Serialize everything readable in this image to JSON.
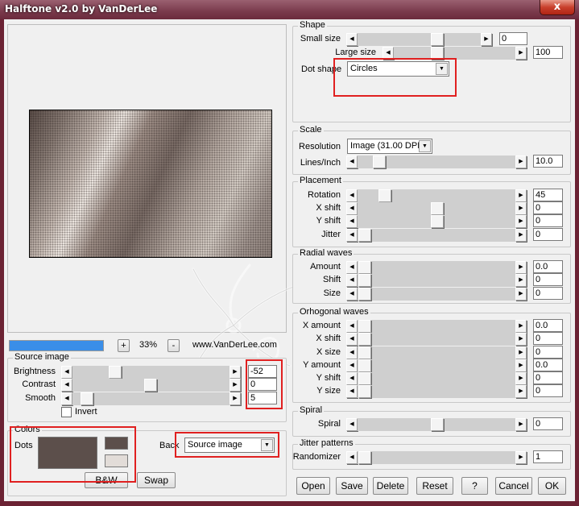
{
  "window": {
    "title": "Halftone v2.0 by VanDerLee",
    "close_glyph": "x"
  },
  "preview": {
    "zoom_minus": "+",
    "zoom_value": "33%",
    "zoom_plus": "-",
    "website": "www.VanDerLee.com"
  },
  "source_image": {
    "legend": "Source image",
    "brightness_label": "Brightness",
    "brightness_value": "-52",
    "contrast_label": "Contrast",
    "contrast_value": "0",
    "smooth_label": "Smooth",
    "smooth_value": "5",
    "invert_label": "Invert"
  },
  "colors": {
    "legend": "Colors",
    "dots_label": "Dots",
    "dots_color": "#5c4f4b",
    "fg_color": "#5c4f4b",
    "bg_color": "#e2dcd8",
    "bw_label": "B&W",
    "swap_label": "Swap",
    "back_label": "Back",
    "back_value": "Source image"
  },
  "shape": {
    "legend": "Shape",
    "small_size_label": "Small size",
    "small_size_value": "0",
    "large_size_label": "Large size",
    "large_size_value": "100",
    "dot_shape_label": "Dot shape",
    "dot_shape_value": "Circles"
  },
  "scale": {
    "legend": "Scale",
    "resolution_label": "Resolution",
    "resolution_value": "Image (31.00 DPI",
    "lines_label": "Lines/Inch",
    "lines_value": "10.0"
  },
  "placement": {
    "legend": "Placement",
    "rotation_label": "Rotation",
    "rotation_value": "45",
    "xshift_label": "X shift",
    "xshift_value": "0",
    "yshift_label": "Y shift",
    "yshift_value": "0",
    "jitter_label": "Jitter",
    "jitter_value": "0"
  },
  "radial": {
    "legend": "Radial waves",
    "amount_label": "Amount",
    "amount_value": "0.0",
    "shift_label": "Shift",
    "shift_value": "0",
    "size_label": "Size",
    "size_value": "0"
  },
  "orhogonal": {
    "legend": "Orhogonal waves",
    "xamount_label": "X amount",
    "xamount_value": "0.0",
    "xshift_label": "X shift",
    "xshift_value": "0",
    "xsize_label": "X size",
    "xsize_value": "0",
    "yamount_label": "Y amount",
    "yamount_value": "0.0",
    "yshift_label": "Y shift",
    "yshift_value": "0",
    "ysize_label": "Y size",
    "ysize_value": "0"
  },
  "spiral": {
    "legend": "Spiral",
    "spiral_label": "Spiral",
    "spiral_value": "0"
  },
  "jitter_patterns": {
    "legend": "Jitter patterns",
    "randomizer_label": "Randomizer",
    "randomizer_value": "1"
  },
  "buttons": {
    "open": "Open",
    "save": "Save",
    "delete": "Delete",
    "reset": "Reset",
    "help": "?",
    "cancel": "Cancel",
    "ok": "OK"
  },
  "accent_colors": {
    "highlight_box": "#e02020",
    "progress_bar": "#3a8ee8",
    "title_bar": "#6b2233"
  }
}
